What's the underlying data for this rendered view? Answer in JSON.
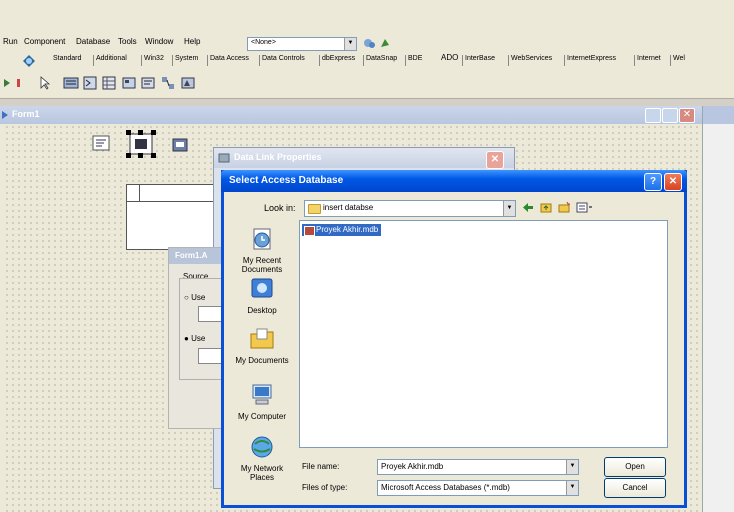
{
  "menubar": {
    "items": [
      "Run",
      "Component",
      "Database",
      "Tools",
      "Window",
      "Help"
    ],
    "config_value": "<None>"
  },
  "palette": {
    "tabs": [
      "Standard",
      "Additional",
      "Win32",
      "System",
      "Data Access",
      "Data Controls",
      "dbExpress",
      "DataSnap",
      "BDE",
      "ADO",
      "InterBase",
      "WebServices",
      "InternetExpress",
      "Internet",
      "Wel"
    ]
  },
  "form1": {
    "title": "Form1"
  },
  "data_link_dialog": {
    "title": "Data Link Properties"
  },
  "form1a": {
    "title": "Form1.A",
    "group_label": "Source",
    "option_1": "Use",
    "option_2": "Use"
  },
  "select_dialog": {
    "title": "Select Access Database",
    "look_in_label": "Look in:",
    "look_in_value": "insert databse",
    "places": [
      {
        "label": "My Recent Documents",
        "icon": "recent-documents-icon"
      },
      {
        "label": "Desktop",
        "icon": "desktop-icon"
      },
      {
        "label": "My Documents",
        "icon": "my-documents-icon"
      },
      {
        "label": "My Computer",
        "icon": "my-computer-icon"
      },
      {
        "label": "My Network Places",
        "icon": "network-places-icon"
      }
    ],
    "files": [
      "Proyek Akhir.mdb"
    ],
    "file_name_label": "File name:",
    "file_name_value": "Proyek Akhir.mdb",
    "file_type_label": "Files of type:",
    "file_type_value": "Microsoft Access Databases (*.mdb)",
    "open_label": "Open",
    "cancel_label": "Cancel"
  },
  "colors": {
    "xp_title": "#0058e6",
    "selection": "#316ac5",
    "close_red": "#e0533b"
  }
}
